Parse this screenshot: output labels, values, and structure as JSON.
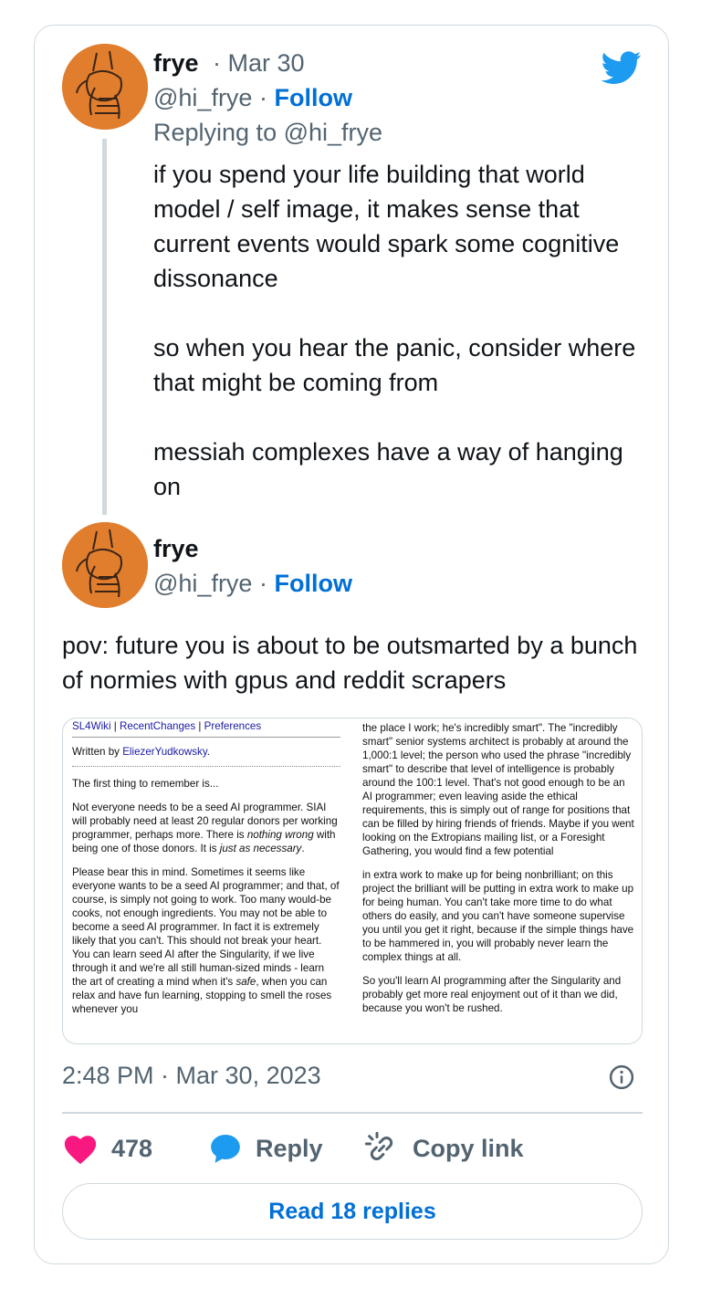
{
  "colors": {
    "accent": "#006fd6",
    "like": "#f91880",
    "muted": "#536471",
    "twitter_blue": "#1d9bf0"
  },
  "tweet1": {
    "name": "frye",
    "date": "· Mar 30",
    "handle": "@hi_frye ·",
    "follow": "Follow",
    "replying_to": "Replying to @hi_frye",
    "paragraphs": [
      "if you spend your life building that world model / self image, it makes sense that current events would spark some cognitive dissonance",
      "so when you hear the panic, consider where that might be coming from",
      "messiah complexes have a way of hanging on"
    ]
  },
  "tweet2": {
    "name": "frye",
    "handle": "@hi_frye ·",
    "follow": "Follow",
    "text": "pov: future you is about to be outsmarted by a bunch of normies with gpus and reddit scrapers",
    "image": {
      "left": {
        "nav": [
          "SL4Wiki",
          "RecentChanges",
          "Preferences"
        ],
        "nav_sep": "|",
        "written_by_prefix": "Written by ",
        "author": "EliezerYudkowsky",
        "written_by_suffix": ".",
        "p1": "The first thing to remember is...",
        "p2a": "Not everyone needs to be a seed AI programmer. SIAI will probably need at least 20 regular donors per working programmer, perhaps more. There is ",
        "p2b": "nothing wrong",
        "p2c": " with being one of those donors. It is ",
        "p2d": "just as necessary",
        "p2e": ".",
        "p3a": "Please bear this in mind. Sometimes it seems like everyone wants to be a seed AI programmer; and that, of course, is simply not going to work. Too many would-be cooks, not enough ingredients. You may not be able to become a seed AI programmer. In fact it is extremely likely that you can't. This should not break your heart. You can learn seed AI after the Singularity, if we live through it and we're all still human-sized minds - learn the art of creating a mind when it's ",
        "p3b": "safe",
        "p3c": ", when you can relax and have fun learning, stopping to smell the roses whenever you"
      },
      "right": {
        "p1": "the place I work; he's incredibly smart\". The \"incredibly smart\" senior systems architect is probably at around the 1,000:1 level; the person who used the phrase \"incredibly smart\" to describe that level of intelligence is probably around the 100:1 level. That's not good enough to be an AI programmer; even leaving aside the ethical requirements, this is simply out of range for positions that can be filled by hiring friends of friends. Maybe if you went looking on the Extropians mailing list, or a Foresight Gathering, you would find a few potential",
        "p2": "in extra work to make up for being nonbrilliant; on this project the brilliant will be putting in extra work to make up for being human. You can't take more time to do what others do easily, and you can't have someone supervise you until you get it right, because if the simple things have to be hammered in, you will probably never learn the complex things at all.",
        "p3": "So you'll learn AI programming after the Singularity and probably get more real enjoyment out of it than we did, because you won't be rushed."
      }
    }
  },
  "meta": {
    "time": "2:48 PM · Mar 30, 2023"
  },
  "actions": {
    "likes": "478",
    "reply": "Reply",
    "copy_link": "Copy link"
  },
  "read_replies": "Read 18 replies"
}
